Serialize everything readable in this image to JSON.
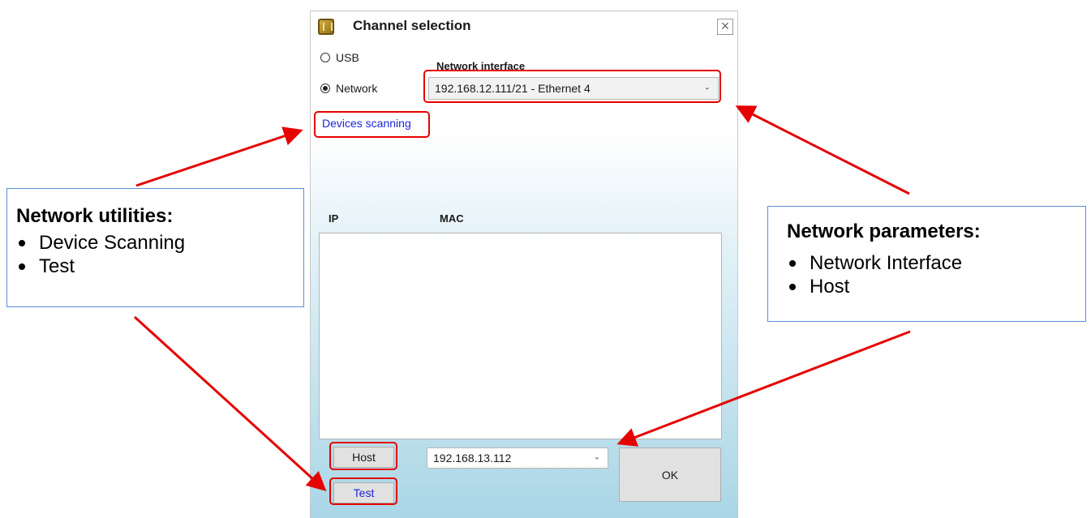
{
  "dialog": {
    "title": "Channel selection",
    "close_glyph": "×",
    "usb_label": "USB",
    "network_label": "Network",
    "network_interface_label": "Network interface",
    "network_interface_value": "192.168.12.111/21 - Ethernet 4",
    "devices_scanning_label": "Devices scanning",
    "columns": [
      "IP",
      "MAC"
    ],
    "host_button_label": "Host",
    "host_value": "192.168.13.112",
    "test_button_label": "Test",
    "ok_button_label": "OK",
    "selected_channel": "Network"
  },
  "callouts": {
    "left": {
      "heading": "Network utilities:",
      "items": [
        "Device Scanning",
        "Test"
      ]
    },
    "right": {
      "heading": "Network parameters:",
      "items": [
        "Network Interface",
        "Host"
      ]
    }
  },
  "colors": {
    "highlight": "#e60000",
    "link": "#1a23d8",
    "callout_border": "#5b8fd6"
  }
}
